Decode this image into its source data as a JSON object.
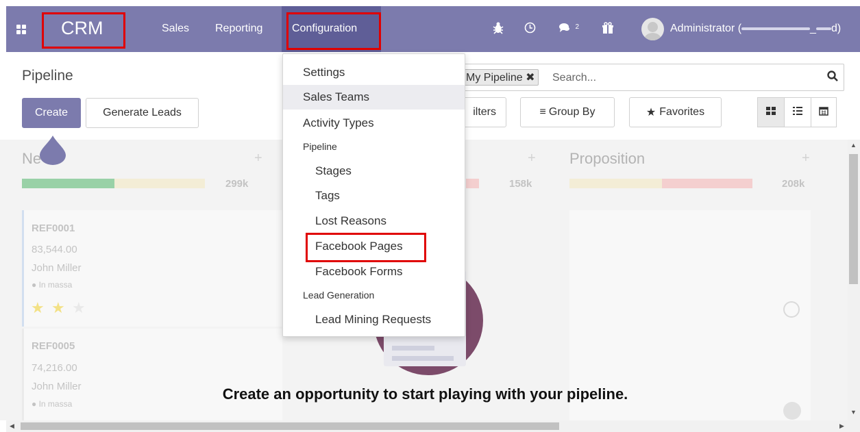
{
  "navbar": {
    "brand": "CRM",
    "menu": [
      "Sales",
      "Reporting",
      "Configuration"
    ],
    "messages_count": "2",
    "user": "Administrator (",
    "user_suffix": "_",
    "user_end": "d)",
    "bg_color": "#7c7bad",
    "icons": [
      "apps-icon",
      "bug-icon",
      "clock-icon",
      "chat-icon",
      "gift-icon"
    ]
  },
  "control_panel": {
    "title": "Pipeline",
    "create_label": "Create",
    "generate_leads_label": "Generate Leads",
    "search": {
      "facet": "My Pipeline",
      "placeholder": "Search..."
    },
    "filters_label": "ilters",
    "group_by_label": "Group By",
    "favorites_label": "Favorites",
    "views": [
      "kanban-icon",
      "list-icon",
      "calendar-icon"
    ]
  },
  "dropdown": {
    "items": [
      {
        "label": "Settings",
        "indent": false
      },
      {
        "label": "Sales Teams",
        "indent": false,
        "active": true
      },
      {
        "label": "Activity Types",
        "indent": false
      },
      {
        "label": "Stages",
        "indent": true
      },
      {
        "label": "Tags",
        "indent": true
      },
      {
        "label": "Lost Reasons",
        "indent": true
      },
      {
        "label": "Facebook Pages",
        "indent": true,
        "highlighted": true
      },
      {
        "label": "Facebook Forms",
        "indent": true
      },
      {
        "label": "Lead Mining Requests",
        "indent": true
      }
    ],
    "headers": [
      "Pipeline",
      "Lead Generation"
    ]
  },
  "kanban": {
    "columns": [
      {
        "title": "Ne",
        "total": "299k"
      },
      {
        "title": "",
        "total": "158k"
      },
      {
        "title": "Proposition",
        "total": "208k"
      }
    ],
    "cards": [
      {
        "ref": "REF0001",
        "amount": "83,544.00",
        "contact": "John Miller",
        "tag": "In massa"
      },
      {
        "ref": "REF0005",
        "amount": "74,216.00",
        "contact": "John Miller",
        "tag": "In massa"
      }
    ],
    "empty_message": "Create an opportunity to start playing with your pipeline."
  }
}
